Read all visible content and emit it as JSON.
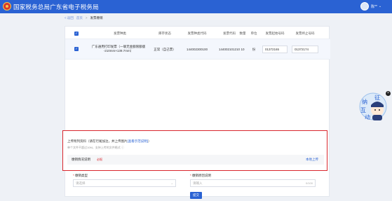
{
  "header": {
    "app_title": "国家税务总局广东省电子税务局",
    "user_name": "陈**",
    "user_caret": "⌄"
  },
  "breadcrumb": {
    "back": "< 返回",
    "home": "首页",
    "separator": ">",
    "current": "发票缴销"
  },
  "table": {
    "headers": [
      "发票种类",
      "库存状态",
      "发票种类代码",
      "发票代码",
      "数量",
      "单位",
      "发票起始号码",
      "发票终止号码"
    ],
    "rows": [
      {
        "checked": true,
        "kind_line1": "广东通用打印发票（一联无金额限额版",
        "kind_line2": "-210mm×139.7mm）",
        "status": "正常（自己票）",
        "kind_code": "144002300100",
        "invoice_code": "144002101210",
        "quantity": "10",
        "unit": "份",
        "start_no": "01372165",
        "end_no": "01372174"
      }
    ]
  },
  "upload": {
    "title_prefix": "上传附列资料（请在行尾加注，并上传图片",
    "title_link": "[查看示范说明]",
    "title_suffix": "）",
    "subtitle": "单个文件不超过10M，支持上传的文件格式",
    "row_label": "缴销情况说明",
    "required": "必报",
    "button": "本地上传"
  },
  "form": {
    "type_label": "缴销类型",
    "type_placeholder": "请选择",
    "reason_label": "缴销原因说明",
    "reason_placeholder": "请输入",
    "reason_count": "0/100",
    "required_mark": "*",
    "submit": "提交"
  },
  "assistant": {
    "badge_chars": [
      "征",
      "纳",
      "互",
      "动"
    ],
    "close": "×"
  },
  "colors": {
    "primary": "#2a62d3",
    "highlight_border": "#d9262d"
  }
}
